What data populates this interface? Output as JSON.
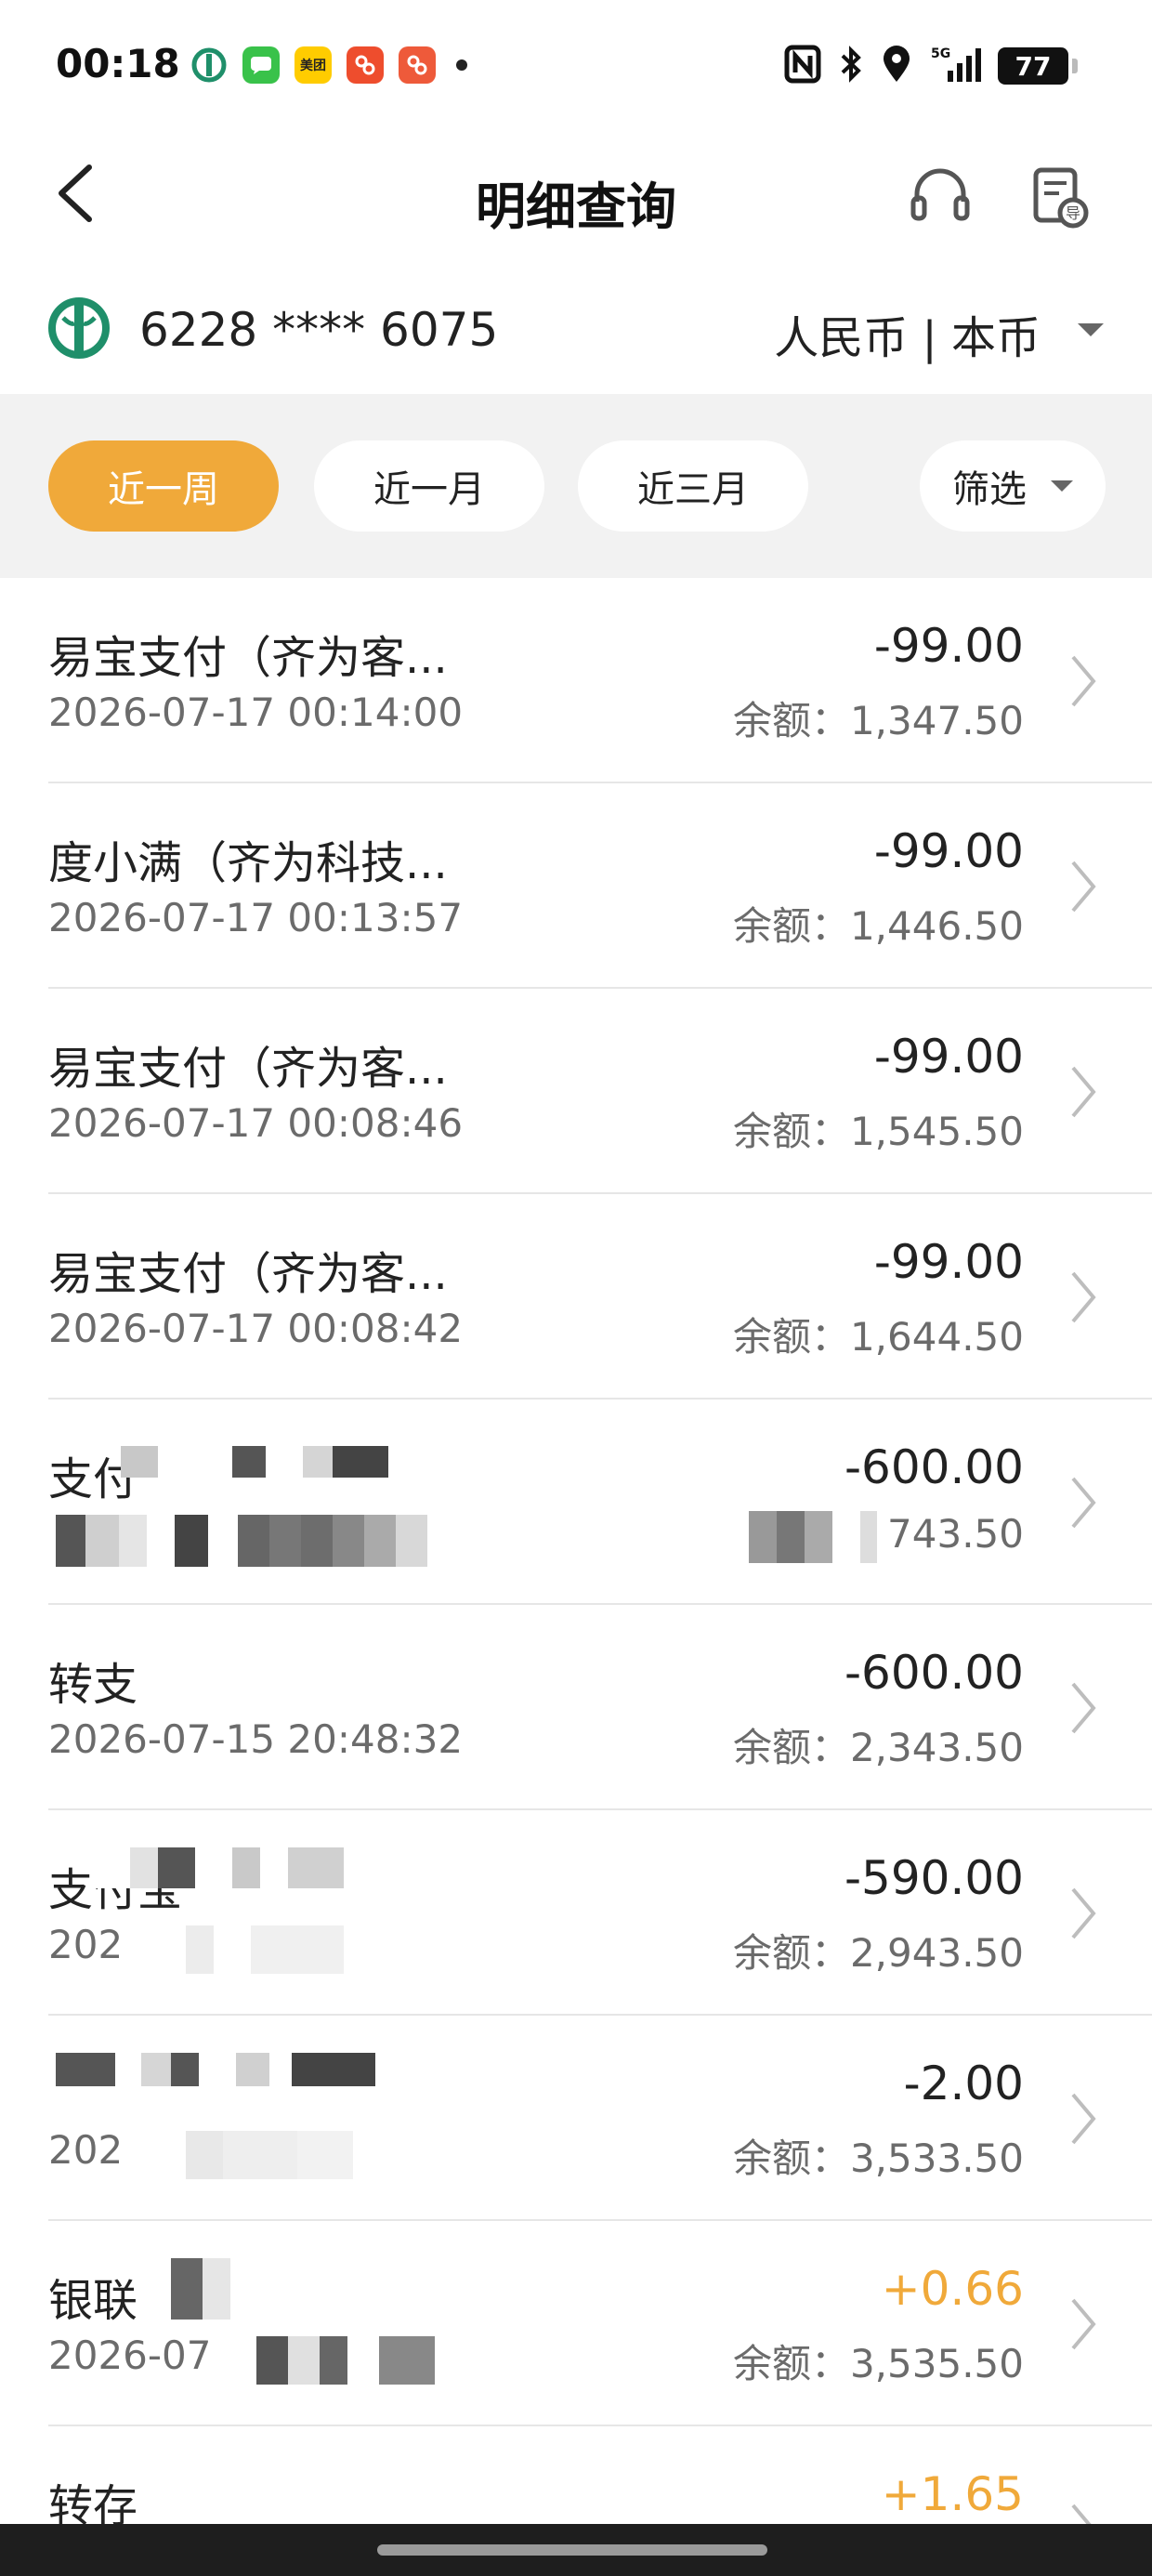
{
  "status_bar": {
    "time": "00:18",
    "battery": "77",
    "app_icons": [
      {
        "name": "abc-bank-app-icon",
        "color": "#ffffff",
        "label": ""
      },
      {
        "name": "messages-app-icon",
        "color": "#39c24a",
        "label": ""
      },
      {
        "name": "meituan-app-icon",
        "color": "#ffcc00",
        "label": "美团"
      },
      {
        "name": "pdd-app-icon",
        "color": "#ee4d2d",
        "label": ""
      },
      {
        "name": "pdd-alt-app-icon",
        "color": "#ee5a3a",
        "label": ""
      }
    ]
  },
  "header": {
    "title": "明细查询"
  },
  "account": {
    "card_number": "6228 **** 6075",
    "currency": "人民币 | 本币"
  },
  "filters": {
    "week": "近一周",
    "month": "近一月",
    "three_months": "近三月",
    "filter": "筛选"
  },
  "colors": {
    "accent": "#f0a93a",
    "bank_green": "#1f8f6a"
  },
  "transactions": [
    {
      "name": "易宝支付（齐为客...",
      "date": "2026-07-17 00:14:00",
      "amount": "-99.00",
      "balance": "余额：1,347.50",
      "type": "expense"
    },
    {
      "name": "度小满（齐为科技...",
      "date": "2026-07-17 00:13:57",
      "amount": "-99.00",
      "balance": "余额：1,446.50",
      "type": "expense"
    },
    {
      "name": "易宝支付（齐为客...",
      "date": "2026-07-17 00:08:46",
      "amount": "-99.00",
      "balance": "余额：1,545.50",
      "type": "expense"
    },
    {
      "name": "易宝支付（齐为客...",
      "date": "2026-07-17 00:08:42",
      "amount": "-99.00",
      "balance": "余额：1,644.50",
      "type": "expense"
    },
    {
      "name": "支付",
      "date": "",
      "amount": "-600.00",
      "balance": "743.50",
      "type": "expense"
    },
    {
      "name": "转支",
      "date": "2026-07-15 20:48:32",
      "amount": "-600.00",
      "balance": "余额：2,343.50",
      "type": "expense"
    },
    {
      "name": "支付宝",
      "date": "202",
      "amount": "-590.00",
      "balance": "余额：2,943.50",
      "type": "expense"
    },
    {
      "name": "",
      "date": "202",
      "amount": "-2.00",
      "balance": "余额：3,533.50",
      "type": "expense"
    },
    {
      "name": "银联",
      "date": "2026-07",
      "amount": "+0.66",
      "balance": "余额：3,535.50",
      "type": "income"
    },
    {
      "name": "转存",
      "date": "",
      "amount": "+1.65",
      "balance": "",
      "type": "income"
    }
  ]
}
